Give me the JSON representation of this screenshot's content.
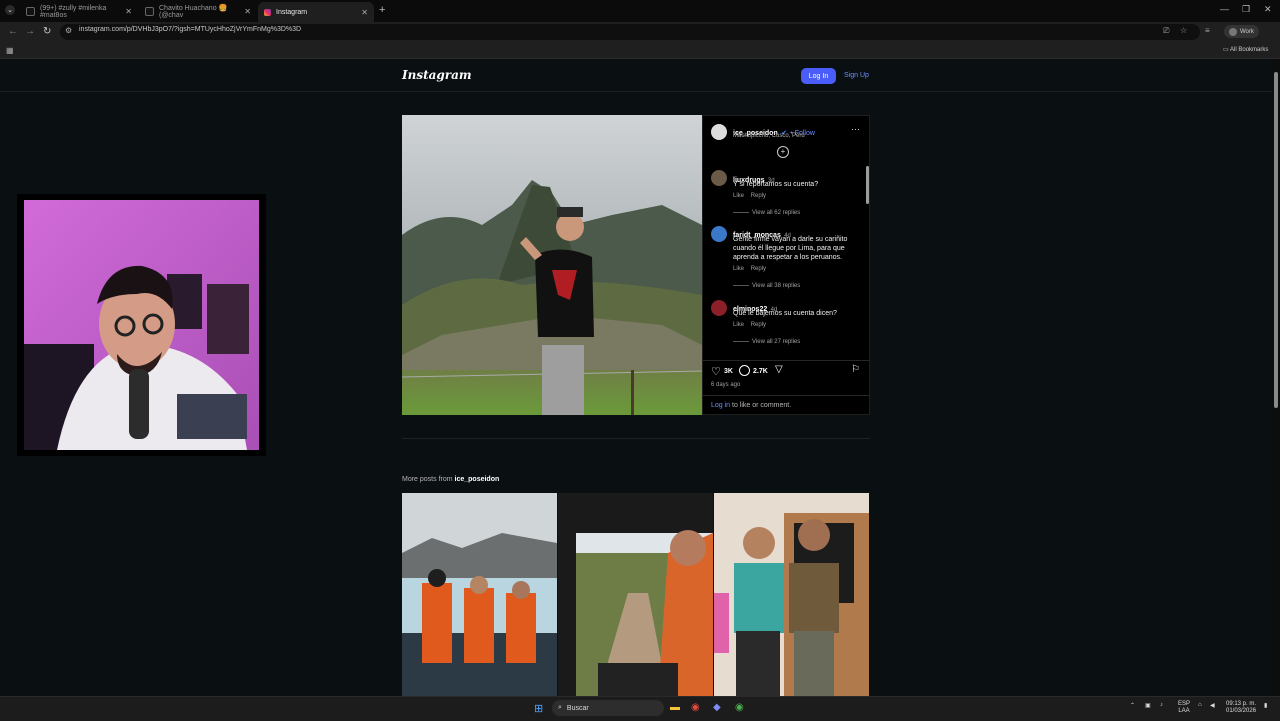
{
  "browser": {
    "tabs": [
      {
        "label": "(99+) #zully #milenka #mat8os",
        "color": "#ffffff"
      },
      {
        "label": "Chavito Huachano 🍔 (@chav",
        "color": "#ffffff"
      },
      {
        "label": "Instagram",
        "color": "#e1306c"
      }
    ],
    "url": "instagram.com/p/DVHbJ3pO7/?igsh=MTUycHhoZjVrYmFnMg%3D%3D",
    "profile_label": "Work",
    "all_bookmarks": "All Bookmarks"
  },
  "instagram": {
    "logo": "Instagram",
    "login": "Log In",
    "signup": "Sign Up",
    "post": {
      "author": "ice_poseidon",
      "follow": "• Follow",
      "location": "Machupicchu, Cusco, Peru",
      "comments": [
        {
          "user": "liuxdrugs",
          "time": "3d",
          "text": "Y si reportamos su cuenta?",
          "like": "Like",
          "reply": "Reply",
          "replies": "View all 62 replies"
        },
        {
          "user": "faridt_moncas",
          "time": "4d",
          "text": "Gente firme vayan a darle su cariñito cuando él llegue por Lima, para que aprenda a respetar a los peruanos.",
          "like": "Like",
          "reply": "Reply",
          "replies": "View all 38 replies"
        },
        {
          "user": "elminos22",
          "time": "4d",
          "text": "Que le bajemos su cuenta dicen?",
          "like": "Like",
          "reply": "Reply",
          "replies": "View all 27 replies"
        }
      ],
      "likes": "3K",
      "comment_count": "2.7K",
      "age": "6 days ago",
      "login_link": "Log in",
      "login_rest": " to like or comment."
    },
    "more_posts_prefix": "More posts from ",
    "more_posts_user": "ice_poseidon"
  },
  "taskbar": {
    "search": "Buscar",
    "lang_top": "ESP",
    "lang_bottom": "LAA",
    "time": "09:13 p. m.",
    "date": "01/03/2026"
  }
}
